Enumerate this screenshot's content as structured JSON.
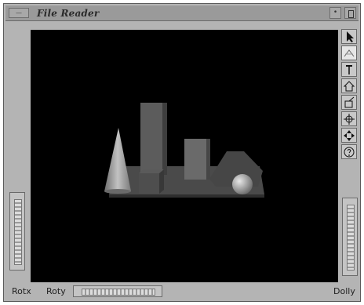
{
  "window": {
    "title": "File Reader",
    "menu_button_label": "—",
    "minimize_label": "•"
  },
  "viewer": {
    "background": "#000000",
    "objects": [
      "cone",
      "box",
      "tall-block",
      "medium-block",
      "cube",
      "wedge",
      "sphere",
      "base-plate"
    ]
  },
  "toolbar": {
    "tools": [
      {
        "name": "pointer-icon"
      },
      {
        "name": "view-icon"
      },
      {
        "name": "home-icon"
      },
      {
        "name": "set-home-icon"
      },
      {
        "name": "view-all-icon"
      },
      {
        "name": "seek-icon"
      },
      {
        "name": "perspective-icon"
      },
      {
        "name": "help-icon"
      }
    ]
  },
  "bottom": {
    "rotx_label": "Rotx",
    "roty_label": "Roty",
    "dolly_label": "Dolly"
  }
}
